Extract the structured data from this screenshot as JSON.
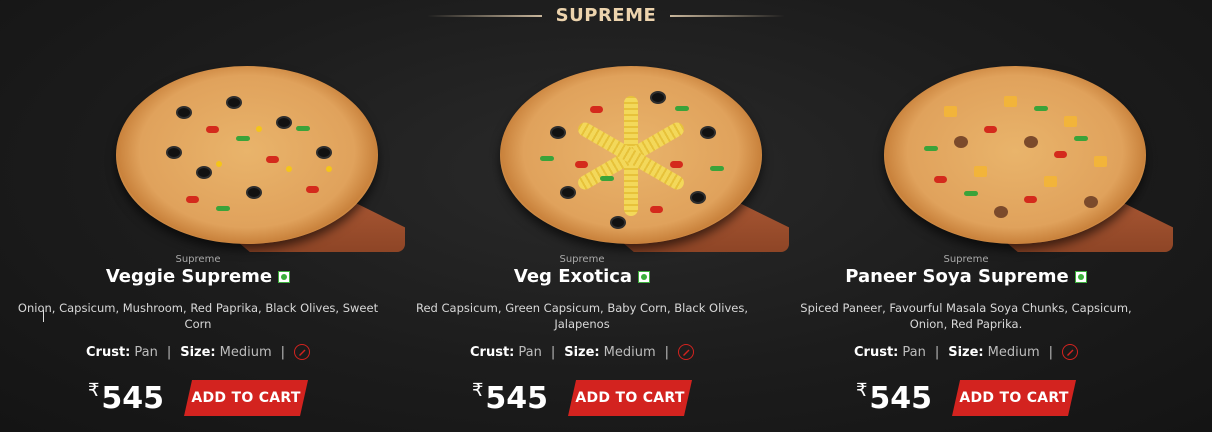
{
  "section": {
    "title": "SUPREME"
  },
  "currency_symbol": "₹",
  "products": [
    {
      "category": "Supreme",
      "name": "Veggie Supreme",
      "description": "Onion, Capsicum, Mushroom, Red Paprika, Black Olives, Sweet Corn",
      "crust_label": "Crust:",
      "crust_value": "Pan",
      "size_label": "Size:",
      "size_value": "Medium",
      "price": "545",
      "add_to_cart_label": "ADD TO CART"
    },
    {
      "category": "Supreme",
      "name": "Veg Exotica",
      "description": "Red Capsicum, Green Capsicum, Baby Corn, Black Olives, Jalapenos",
      "crust_label": "Crust:",
      "crust_value": "Pan",
      "size_label": "Size:",
      "size_value": "Medium",
      "price": "545",
      "add_to_cart_label": "ADD TO CART"
    },
    {
      "category": "Supreme",
      "name": "Paneer Soya Supreme",
      "description": "Spiced Paneer, Favourful Masala Soya Chunks, Capsicum, Onion, Red Paprika.",
      "crust_label": "Crust:",
      "crust_value": "Pan",
      "size_label": "Size:",
      "size_value": "Medium",
      "price": "545",
      "add_to_cart_label": "ADD TO CART"
    }
  ],
  "colors": {
    "accent_red": "#d3231f",
    "veg_green": "#3caf3c",
    "heading_tan": "#ecd3ad"
  }
}
